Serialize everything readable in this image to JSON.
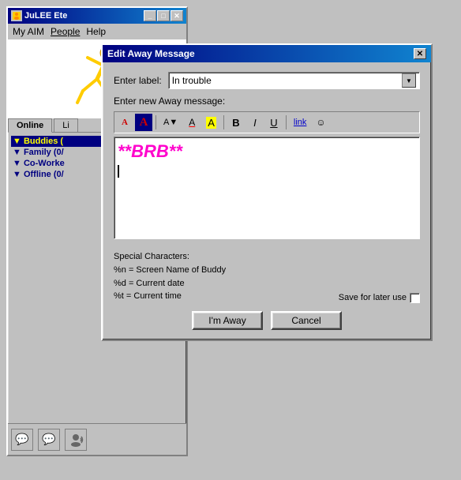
{
  "aim_window": {
    "title": "JuLEE Ete",
    "menu": {
      "my_aim": "My AIM",
      "people": "People",
      "help": "Help"
    },
    "tabs": {
      "online": "Online",
      "list": "Li"
    },
    "buddy_groups": [
      {
        "label": "Buddies (",
        "selected": true
      },
      {
        "label": "Family (0/",
        "selected": false
      },
      {
        "label": "Co-Worke",
        "selected": false
      },
      {
        "label": "Offline (0/",
        "selected": false
      }
    ],
    "titlebar_buttons": [
      "_",
      "□",
      "✕"
    ]
  },
  "dialog": {
    "title": "Edit Away Message",
    "label_field": {
      "label": "Enter label:",
      "value": "In trouble"
    },
    "message_field": {
      "label": "Enter new Away message:"
    },
    "message_text": "**BRB**",
    "toolbar": {
      "btns": [
        "A",
        "A",
        "A▼",
        "A",
        "A",
        "B",
        "I",
        "U",
        "link",
        "☺"
      ]
    },
    "special_chars": {
      "title": "Special Characters:",
      "rows": [
        "%n  =  Screen Name of Buddy",
        "%d  =  Current date",
        "%t   =  Current time"
      ]
    },
    "save_label": "Save for later use",
    "buttons": {
      "away": "I'm Away",
      "cancel": "Cancel"
    }
  },
  "statusbar": {
    "icons": [
      "💬",
      "💬",
      "👤"
    ]
  }
}
